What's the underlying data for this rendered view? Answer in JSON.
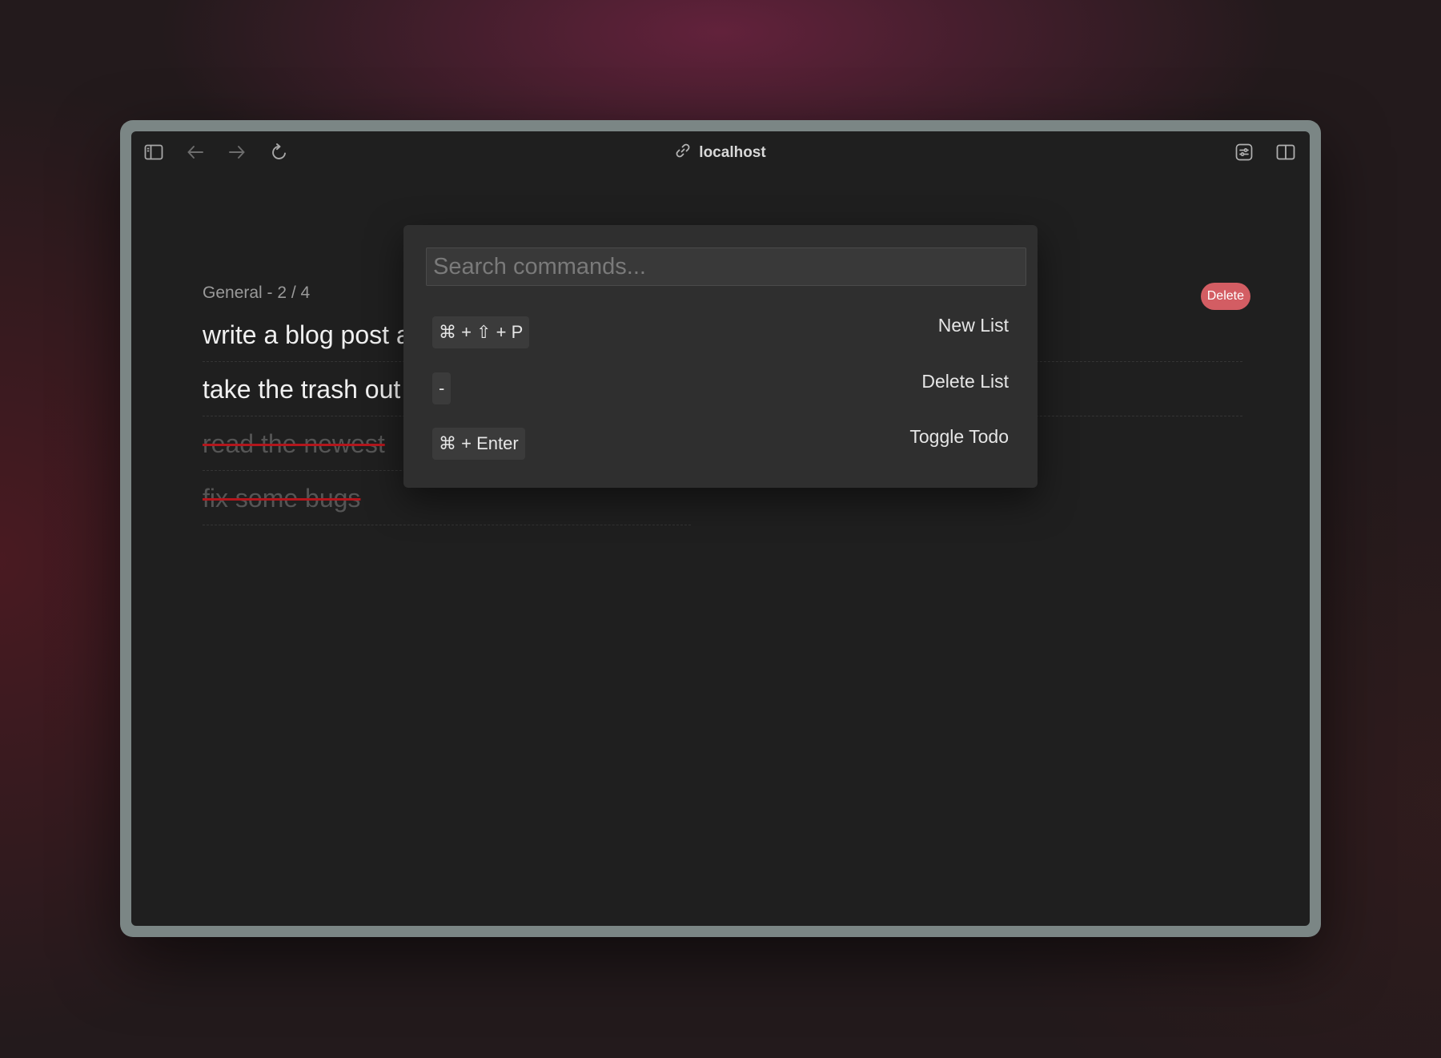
{
  "browser": {
    "address": "localhost"
  },
  "list": {
    "header": "General - 2 / 4",
    "delete_label": "Delete",
    "todos": [
      {
        "text": "write a blog post about how to train agents",
        "done": false
      },
      {
        "text": "take the trash out",
        "done": false
      },
      {
        "text": "read the newest",
        "done": true
      },
      {
        "text": "fix some bugs",
        "done": true
      }
    ]
  },
  "palette": {
    "search_placeholder": "Search commands...",
    "commands": [
      {
        "shortcut": "⌘ + ⇧ + P",
        "label": "New List"
      },
      {
        "shortcut": "-",
        "label": "Delete List"
      },
      {
        "shortcut": "⌘ + Enter",
        "label": "Toggle Todo"
      }
    ]
  },
  "colors": {
    "accent_delete": "#d35d63",
    "strike": "#b3161c",
    "window_bg": "#1f1f1f",
    "palette_bg": "#2f2f2f"
  },
  "icons": {
    "sidebar": "sidebar-toggle-icon",
    "back": "arrow-left-icon",
    "forward": "arrow-right-icon",
    "reload": "reload-icon",
    "link": "link-icon",
    "settings": "sliders-icon",
    "split": "split-view-icon"
  }
}
